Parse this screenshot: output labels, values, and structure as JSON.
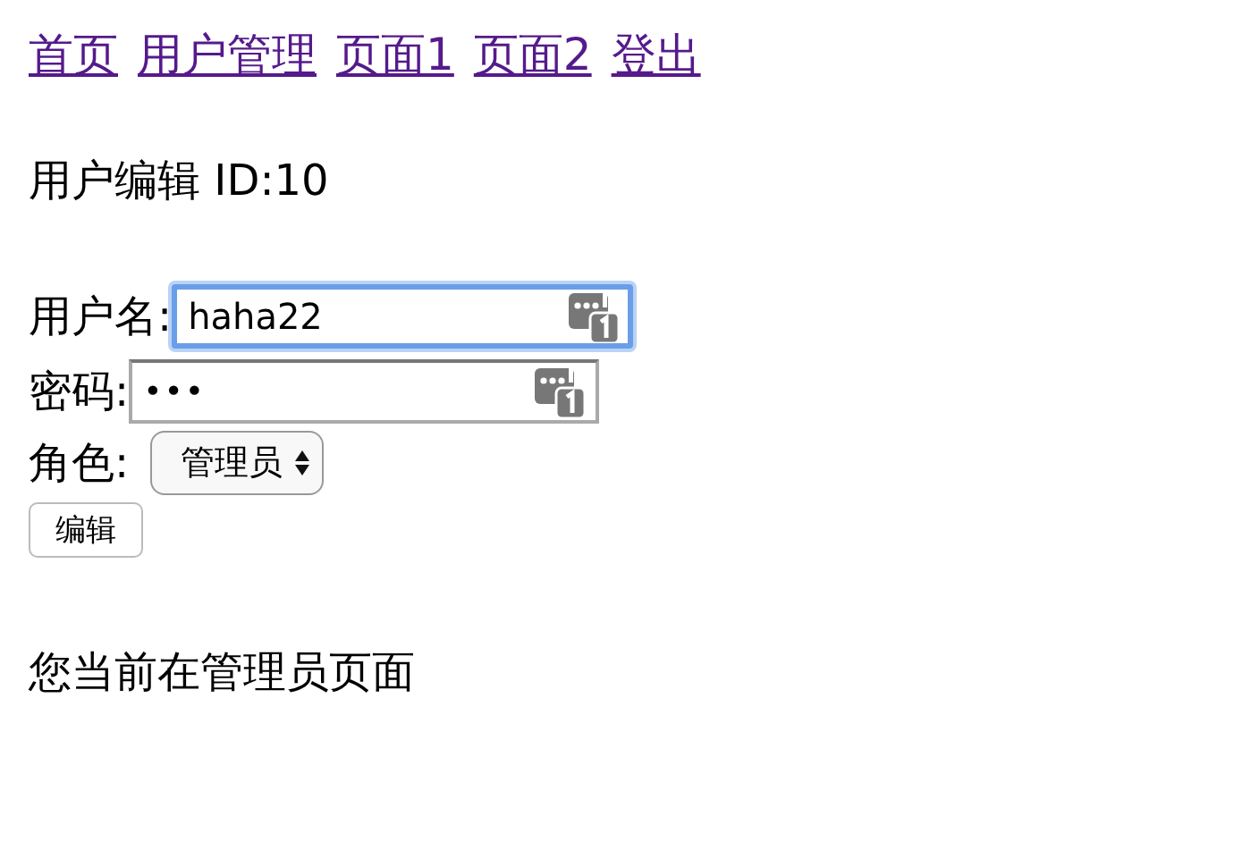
{
  "nav_links": [
    "首页",
    "用户管理",
    "页面1",
    "页面2",
    "登出"
  ],
  "heading": "用户编辑 ID:10",
  "form": {
    "fields": [
      {
        "label": "用户名:",
        "kind": "text",
        "value": "haha22",
        "focused": true
      },
      {
        "label": "密码:",
        "kind": "password",
        "value": "•••",
        "focused": false
      },
      {
        "label": "角色:",
        "kind": "select",
        "value": "管理员",
        "focused": false
      }
    ],
    "submit": "编辑"
  },
  "footer_text": "您当前在管理员页面"
}
